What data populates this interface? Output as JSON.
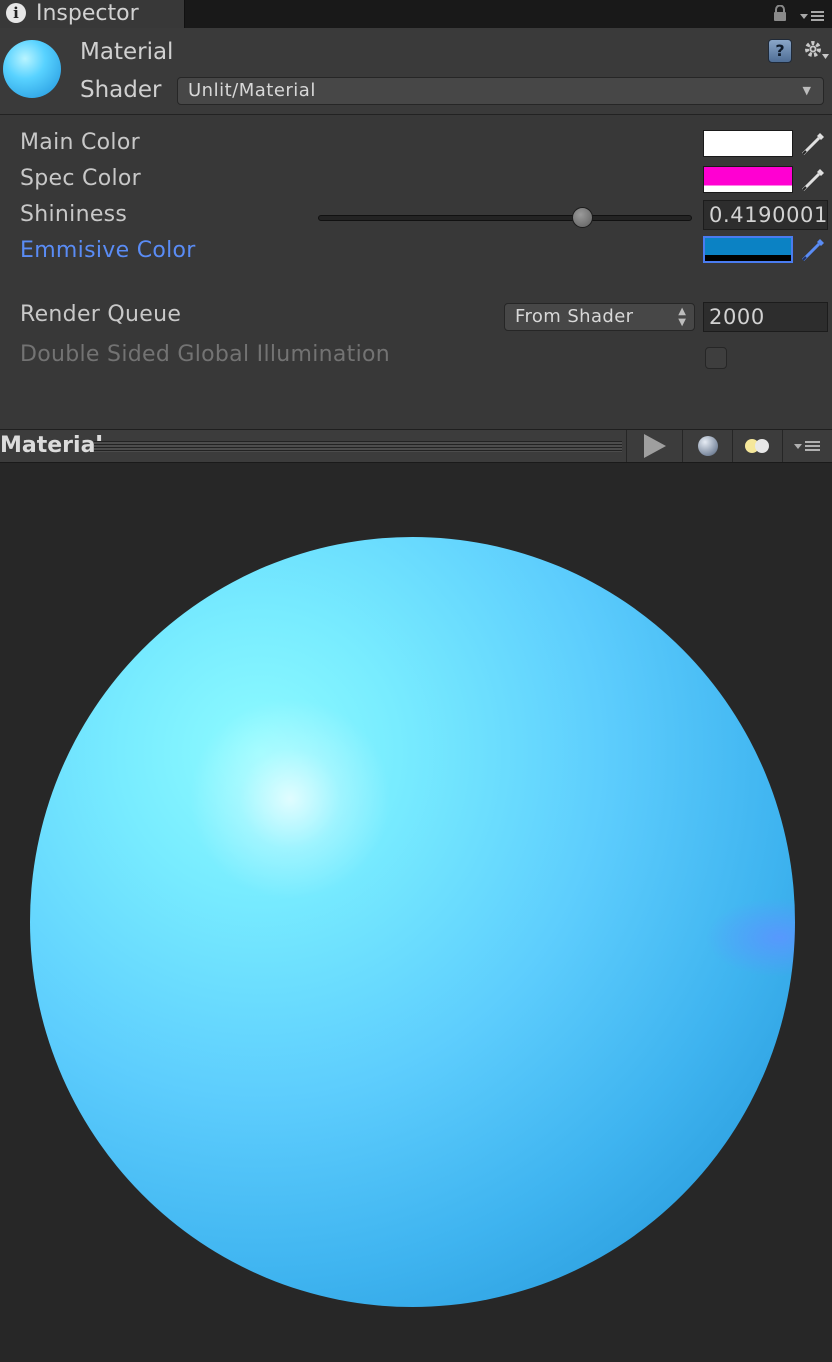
{
  "tab": {
    "title": "Inspector",
    "info_icon": "i"
  },
  "header": {
    "title": "Material",
    "shader_label": "Shader",
    "shader_value": "Unlit/Material",
    "help_glyph": "?"
  },
  "properties": [
    {
      "label": "Main Color",
      "color": "#ffffff",
      "bottom": "#ffffff"
    },
    {
      "label": "Spec Color",
      "color": "#ff00d2",
      "bottom": "#ffffff"
    },
    {
      "label": "Shininess",
      "value": "0.4190001",
      "slider_fraction": 0.72
    },
    {
      "label": "Emmisive Color",
      "color": "#0b82c4",
      "bottom": "#000000",
      "highlighted": true
    }
  ],
  "render_queue": {
    "label": "Render Queue",
    "mode": "From Shader",
    "value": "2000"
  },
  "double_sided_gi": {
    "label": "Double Sided Global Illumination",
    "checked": false
  },
  "preview": {
    "title": "Material"
  },
  "colors": {
    "accent_label": "#5a8cf5",
    "sphere": "#4fc3f7"
  }
}
